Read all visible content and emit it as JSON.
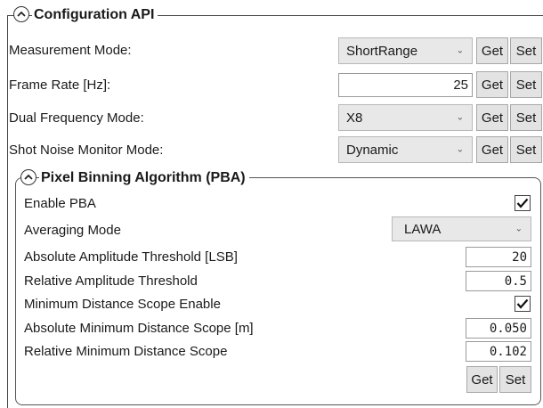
{
  "config": {
    "title": "Configuration API",
    "rows": [
      {
        "label": "Measurement Mode:",
        "value": "ShortRange"
      },
      {
        "label": "Frame Rate [Hz]:",
        "value": "25"
      },
      {
        "label": "Dual Frequency Mode:",
        "value": "X8"
      },
      {
        "label": "Shot Noise Monitor Mode:",
        "value": "Dynamic"
      }
    ],
    "get_label": "Get",
    "set_label": "Set"
  },
  "pba": {
    "title": "Pixel Binning Algorithm (PBA)",
    "enable": {
      "label": "Enable PBA",
      "checked": true
    },
    "averaging": {
      "label": "Averaging Mode",
      "value": "LAWA"
    },
    "abs_amp": {
      "label": "Absolute Amplitude Threshold [LSB]",
      "value": "20"
    },
    "rel_amp": {
      "label": "Relative Amplitude Threshold",
      "value": "0.5"
    },
    "min_dist_enable": {
      "label": "Minimum Distance Scope Enable",
      "checked": true
    },
    "abs_min_dist": {
      "label": "Absolute Minimum Distance Scope [m]",
      "value": "0.050"
    },
    "rel_min_dist": {
      "label": "Relative Minimum Distance Scope",
      "value": "0.102"
    },
    "get_label": "Get",
    "set_label": "Set"
  },
  "icons": {
    "collapse": "chevron-up-icon",
    "dropdown": "chevron-down-icon",
    "check": "checkmark-icon"
  }
}
